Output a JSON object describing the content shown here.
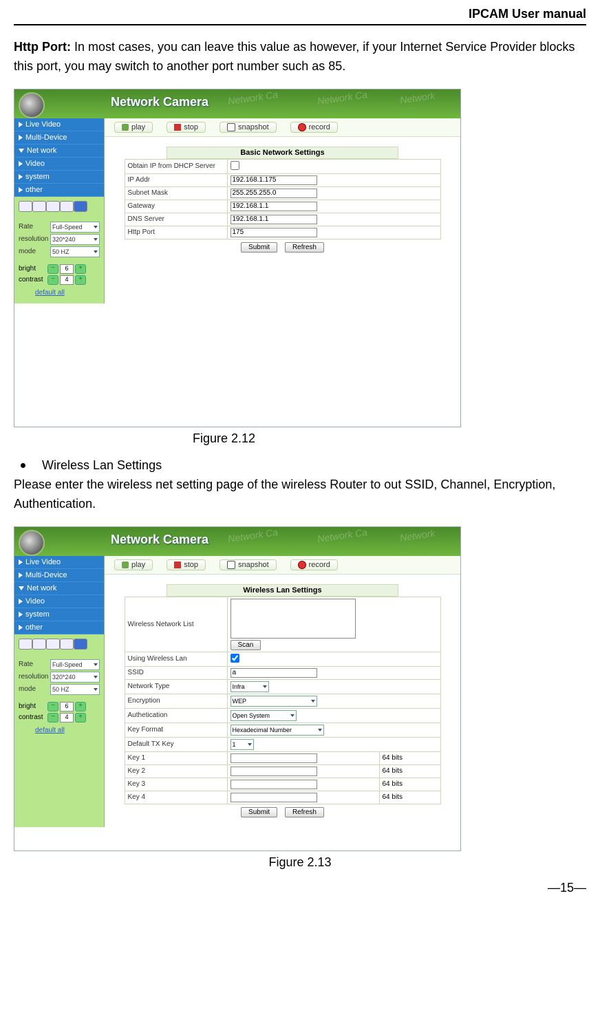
{
  "doc": {
    "header": "IPCAM User manual",
    "http_port_bold": "Http Port:",
    "http_port_rest": " In most cases, you can leave this value as however, if your Internet Service Provider blocks this port, you may switch to another port number such as 85.",
    "fig212": "Figure 2.12",
    "bullet_wlan": "Wireless Lan Settings",
    "wlan_text": "Please enter the wireless net setting page of the wireless Router to out SSID, Channel, Encryption, Authentication.",
    "fig213": "Figure 2.13",
    "page_num": "—15—"
  },
  "camera_ui": {
    "title": "Network Camera",
    "menu": [
      "Live Video",
      "Multi-Device",
      "Net work",
      "Video",
      "system",
      "other"
    ],
    "toolbar": {
      "play": "play",
      "stop": "stop",
      "snapshot": "snapshot",
      "record": "record"
    },
    "controls": {
      "rate_lbl": "Rate",
      "rate_val": "Full-Speed",
      "res_lbl": "resolution",
      "res_val": "320*240",
      "mode_lbl": "mode",
      "mode_val": "50 HZ",
      "bright_lbl": "bright",
      "bright_val": "6",
      "contrast_lbl": "contrast",
      "contrast_val": "4",
      "default": "default all"
    },
    "buttons": {
      "submit": "Submit",
      "refresh": "Refresh",
      "scan": "Scan"
    }
  },
  "fig1": {
    "panel_title": "Basic Network Settings",
    "rows": [
      {
        "label": "Obtain IP from DHCP Server",
        "value": "checkbox",
        "checked": false
      },
      {
        "label": "IP Addr",
        "value": "192.168.1.175"
      },
      {
        "label": "Subnet Mask",
        "value": "255.255.255.0"
      },
      {
        "label": "Gateway",
        "value": "192.168.1.1"
      },
      {
        "label": "DNS Server",
        "value": "192.168.1.1"
      },
      {
        "label": "Http Port",
        "value": "175"
      }
    ]
  },
  "fig2": {
    "panel_title": "Wireless Lan Settings",
    "head": {
      "wlist": "Wireless Network List"
    },
    "rows": {
      "using": "Using Wireless Lan",
      "ssid_lbl": "SSID",
      "ssid_val": "a",
      "ntype_lbl": "Network Type",
      "ntype_val": "Infra",
      "enc_lbl": "Encryption",
      "enc_val": "WEP",
      "auth_lbl": "Authetication",
      "auth_val": "Open System",
      "kf_lbl": "Key Format",
      "kf_val": "Hexadecimal Number",
      "dtx_lbl": "Default TX Key",
      "dtx_val": "1",
      "key1": "Key 1",
      "key2": "Key 2",
      "key3": "Key 3",
      "key4": "Key 4",
      "keybits": "64 bits"
    }
  }
}
